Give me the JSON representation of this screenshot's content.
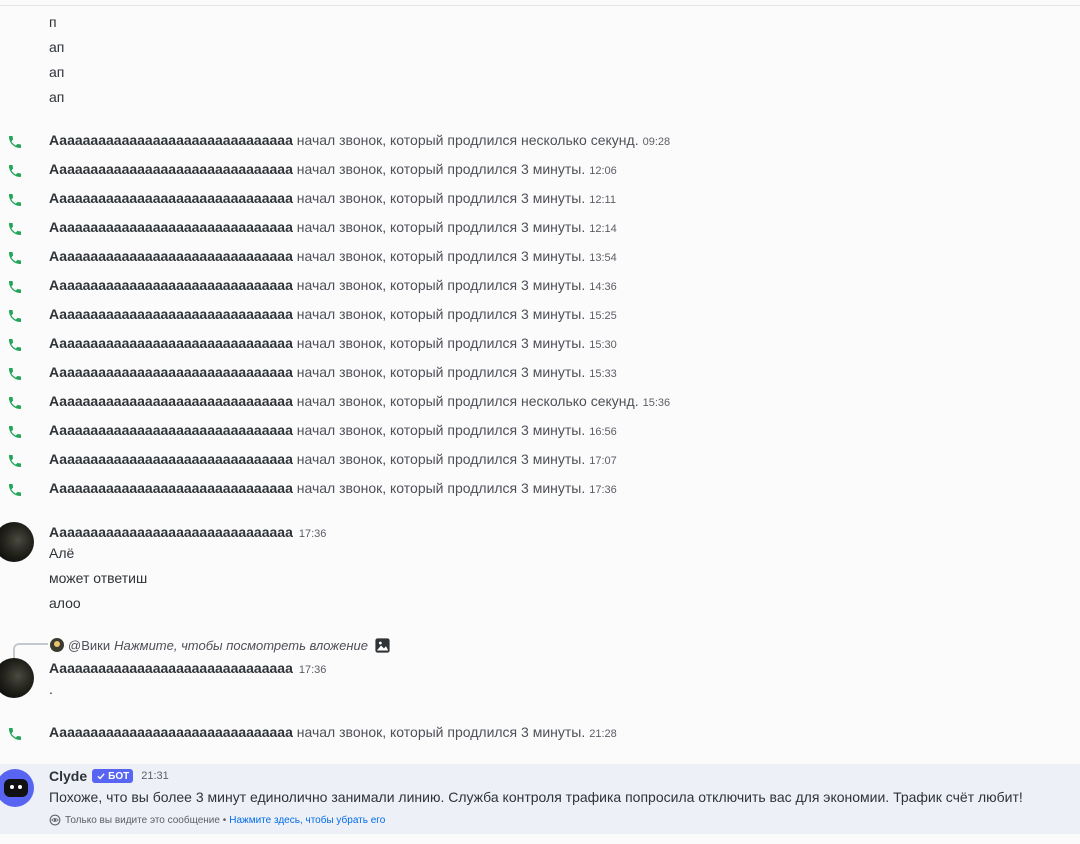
{
  "plain_lines": [
    "п",
    "ап",
    "ап",
    "ап"
  ],
  "call_action_short": "начал звонок, который продлился несколько секунд.",
  "call_action_3min": "начал звонок, который продлился 3 минуты.",
  "calls": [
    {
      "name": "Ааааааааааааааааааааааааааааааа",
      "action": "начал звонок, который продлился несколько секунд.",
      "time": "09:28"
    },
    {
      "name": "Ааааааааааааааааааааааааааааааа",
      "action": "начал звонок, который продлился 3 минуты.",
      "time": "12:06"
    },
    {
      "name": "Ааааааааааааааааааааааааааааааа",
      "action": "начал звонок, который продлился 3 минуты.",
      "time": "12:11"
    },
    {
      "name": "Ааааааааааааааааааааааааааааааа",
      "action": "начал звонок, который продлился 3 минуты.",
      "time": "12:14"
    },
    {
      "name": "Ааааааааааааааааааааааааааааааа",
      "action": "начал звонок, который продлился 3 минуты.",
      "time": "13:54"
    },
    {
      "name": "Ааааааааааааааааааааааааааааааа",
      "action": "начал звонок, который продлился 3 минуты.",
      "time": "14:36"
    },
    {
      "name": "Ааааааааааааааааааааааааааааааа",
      "action": "начал звонок, который продлился 3 минуты.",
      "time": "15:25"
    },
    {
      "name": "Ааааааааааааааааааааааааааааааа",
      "action": "начал звонок, который продлился 3 минуты.",
      "time": "15:30"
    },
    {
      "name": "Ааааааааааааааааааааааааааааааа",
      "action": "начал звонок, который продлился 3 минуты.",
      "time": "15:33"
    },
    {
      "name": "Ааааааааааааааааааааааааааааааа",
      "action": "начал звонок, который продлился несколько секунд.",
      "time": "15:36"
    },
    {
      "name": "Ааааааааааааааааааааааааааааааа",
      "action": "начал звонок, который продлился 3 минуты.",
      "time": "16:56"
    },
    {
      "name": "Ааааааааааааааааааааааааааааааа",
      "action": "начал звонок, который продлился 3 минуты.",
      "time": "17:07"
    },
    {
      "name": "Ааааааааааааааааааааааааааааааа",
      "action": "начал звонок, который продлился 3 минуты.",
      "time": "17:36"
    }
  ],
  "message1": {
    "author": "Ааааааааааааааааааааааааааааааа",
    "time": "17:36",
    "lines": [
      "Алё",
      "может ответиш",
      "алоо"
    ]
  },
  "reply": {
    "mention": "@Вики",
    "text": "Нажмите, чтобы посмотреть вложение"
  },
  "message2": {
    "author": "Ааааааааааааааааааааааааааааааа",
    "time": "17:36",
    "text": "."
  },
  "last_call": {
    "name": "Ааааааааааааааааааааааааааааааа",
    "action": "начал звонок, который продлился 3 минуты.",
    "time": "21:28"
  },
  "bot": {
    "name": "Clyde",
    "tag": "БОТ",
    "time": "21:31",
    "text": "Похоже, что вы более 3 минут единолично занимали линию. Служба контроля трафика попросила отключить вас для экономии. Трафик счёт любит!",
    "ephemeral_note": "Только вы видите это сообщение •",
    "dismiss_link": "Нажмите здесь, чтобы убрать его"
  },
  "colors": {
    "phone": "#23a559",
    "bot_accent": "#5865f2",
    "link": "#006ce7",
    "bot_bg": "#eef0f8"
  }
}
